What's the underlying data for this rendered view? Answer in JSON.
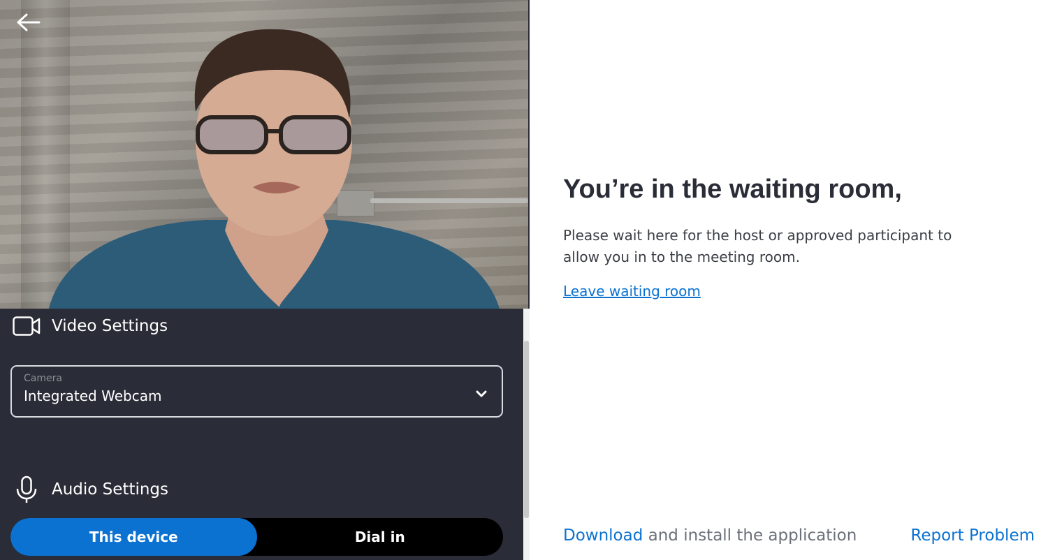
{
  "video_settings": {
    "heading": "Video Settings",
    "camera": {
      "label": "Camera",
      "value": "Integrated Webcam"
    }
  },
  "audio_settings": {
    "heading": "Audio Settings",
    "options": [
      "This device",
      "Dial in"
    ],
    "selected": "This device"
  },
  "waiting_room": {
    "title": "You’re in the waiting room,",
    "message": "Please wait here for the host or approved participant to allow you in to the meeting room.",
    "leave_link": "Leave waiting room"
  },
  "footer": {
    "download_link": "Download",
    "download_text": " and install the application",
    "report_link": "Report Problem"
  },
  "colors": {
    "accent": "#0b72d1",
    "panel_bg": "#2a2d37",
    "toggle_bg": "#000000"
  }
}
